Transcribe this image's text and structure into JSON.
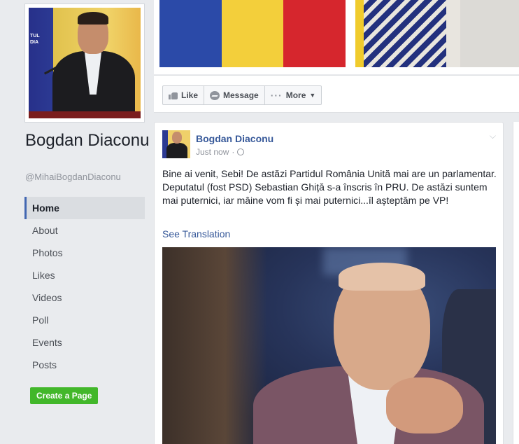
{
  "page": {
    "name": "Bogdan Diaconu",
    "handle": "@MihaiBogdanDiaconu",
    "profile_sign": "TUL\nDIA"
  },
  "nav": {
    "items": [
      {
        "label": "Home",
        "active": true
      },
      {
        "label": "About"
      },
      {
        "label": "Photos"
      },
      {
        "label": "Likes"
      },
      {
        "label": "Videos"
      },
      {
        "label": "Poll"
      },
      {
        "label": "Events"
      },
      {
        "label": "Posts"
      }
    ]
  },
  "create_page_label": "Create a Page",
  "actions": {
    "like": "Like",
    "message": "Message",
    "more": "More"
  },
  "post": {
    "author": "Bogdan Diaconu",
    "time": "Just now",
    "separator": "·",
    "text": "Bine ai venit, Sebi! De astăzi Partidul România Unită mai are un parlamentar. Deputatul (fost PSD) Sebastian Ghiță s-a înscris în PRU. De astăzi suntem mai puternici, iar mâine vom fi și mai puternici...îl așteptăm pe VP!",
    "see_translation": "See Translation"
  },
  "icons": {
    "like": "thumbs-up-icon",
    "message": "messenger-icon",
    "more": "dots-icon",
    "audience": "globe-icon",
    "post_menu": "chevron-down-icon"
  },
  "colors": {
    "link": "#365899",
    "create_button": "#42b72a",
    "active_nav_border": "#4267b2",
    "flag_blue": "#2b4aa8",
    "flag_yellow": "#f3cf3b",
    "flag_red": "#d6262d"
  }
}
